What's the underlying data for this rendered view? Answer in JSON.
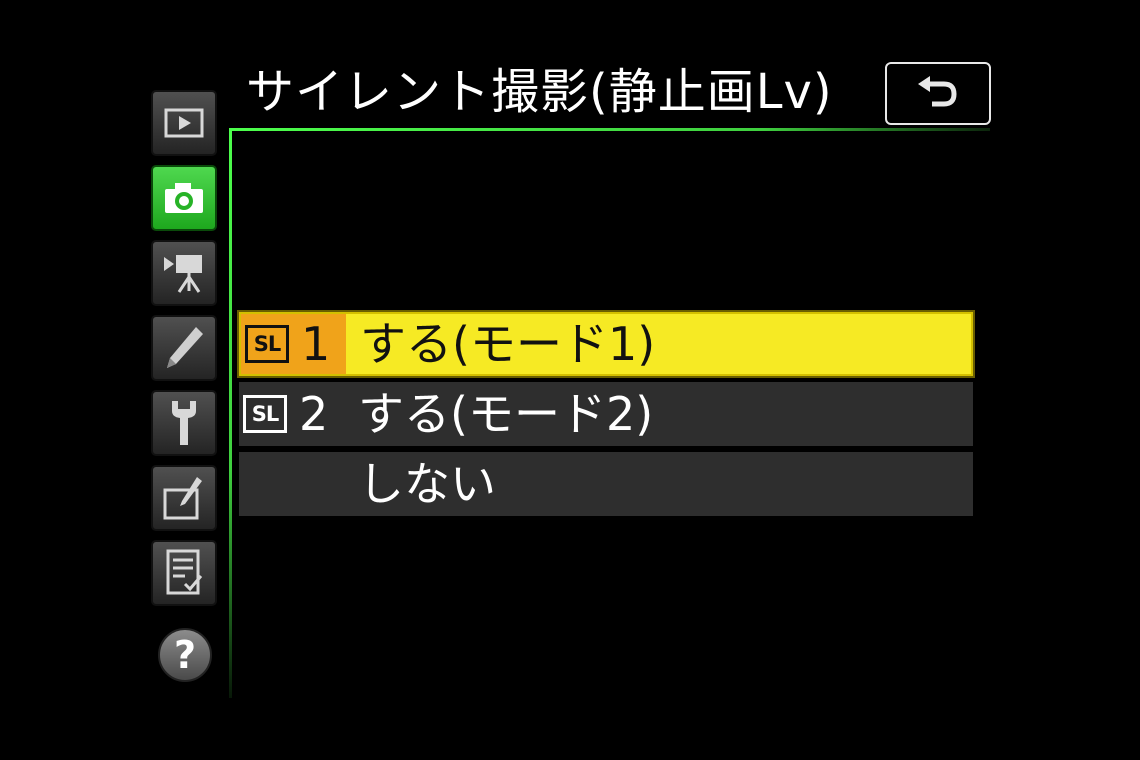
{
  "header": {
    "title": "サイレント撮影(静止画Lv)",
    "back_icon": "return-arrow-icon"
  },
  "sidebar": {
    "tabs": [
      {
        "name": "playback",
        "icon": "playback-icon",
        "active": false
      },
      {
        "name": "photo-shooting",
        "icon": "camera-icon",
        "active": true
      },
      {
        "name": "movie-shooting",
        "icon": "movie-camera-icon",
        "active": false
      },
      {
        "name": "custom-settings",
        "icon": "pencil-icon",
        "active": false
      },
      {
        "name": "setup",
        "icon": "wrench-icon",
        "active": false
      },
      {
        "name": "retouch",
        "icon": "retouch-brush-icon",
        "active": false
      },
      {
        "name": "my-menu",
        "icon": "my-menu-icon",
        "active": false
      }
    ],
    "help_label": "?"
  },
  "options": [
    {
      "badge": "SL",
      "number": "1",
      "label": "する(モード1)",
      "selected": true
    },
    {
      "badge": "SL",
      "number": "2",
      "label": "する(モード2)",
      "selected": false
    },
    {
      "badge": "",
      "number": "",
      "label": "しない",
      "selected": false
    }
  ],
  "colors": {
    "accent_green": "#3fcf3f",
    "selected_row": "#f6ea24",
    "selected_icon_cell": "#f0a31a",
    "row_background": "#2e2e2e"
  }
}
